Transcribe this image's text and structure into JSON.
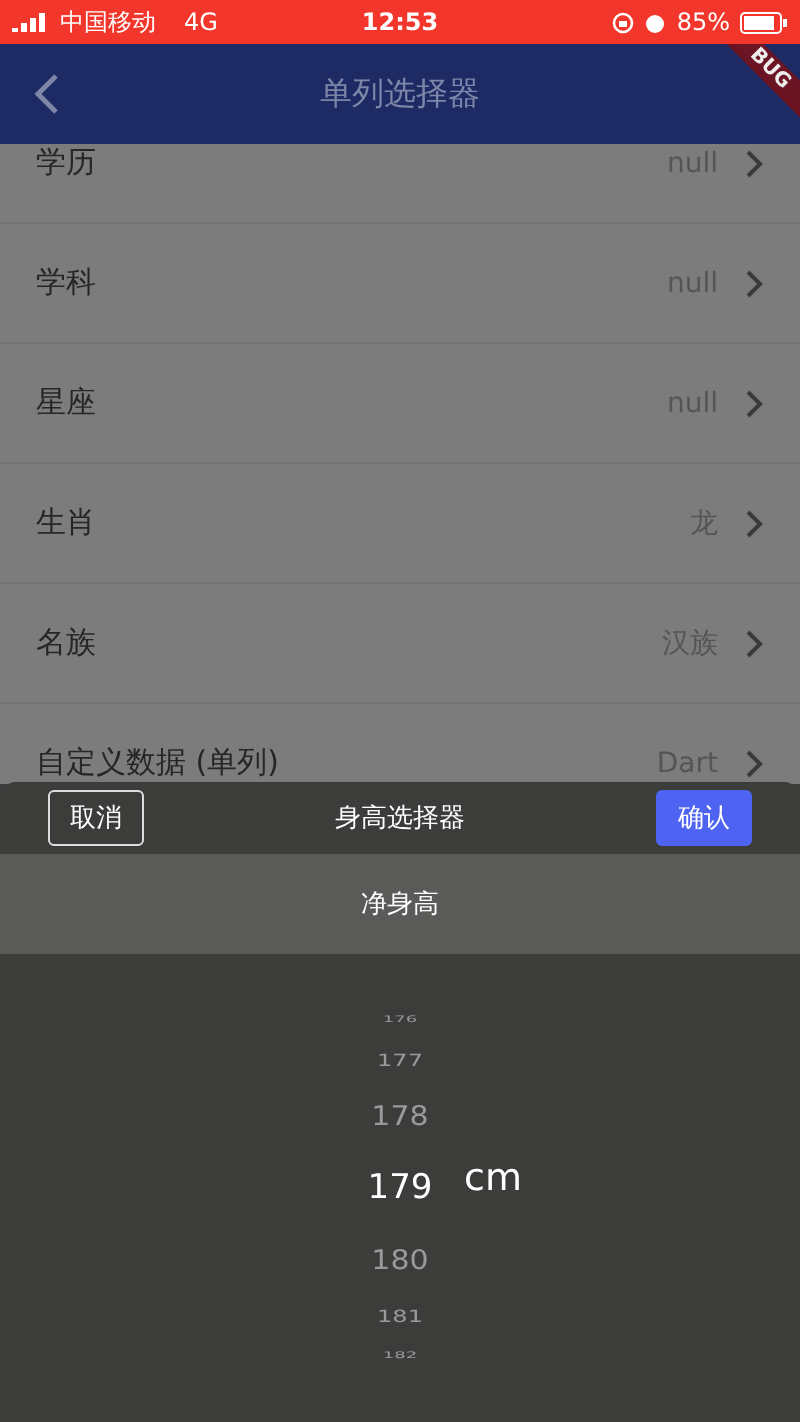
{
  "status_bar": {
    "carrier": "中国移动",
    "network": "4G",
    "time": "12:53",
    "battery": "85%"
  },
  "app_bar": {
    "title": "单列选择器",
    "debug_banner": "BUG"
  },
  "list": [
    {
      "label": "学历",
      "value": "null"
    },
    {
      "label": "学科",
      "value": "null"
    },
    {
      "label": "星座",
      "value": "null"
    },
    {
      "label": "生肖",
      "value": "龙"
    },
    {
      "label": "名族",
      "value": "汉族"
    },
    {
      "label": "自定义数据 (单列)",
      "value": "Dart"
    }
  ],
  "picker": {
    "cancel": "取消",
    "title": "身高选择器",
    "confirm": "确认",
    "subtitle": "净身高",
    "unit": "cm",
    "items": [
      {
        "label": "176",
        "selected": false
      },
      {
        "label": "177",
        "selected": false
      },
      {
        "label": "178",
        "selected": false
      },
      {
        "label": "179",
        "selected": true
      },
      {
        "label": "180",
        "selected": false
      },
      {
        "label": "181",
        "selected": false
      },
      {
        "label": "182",
        "selected": false
      }
    ]
  }
}
